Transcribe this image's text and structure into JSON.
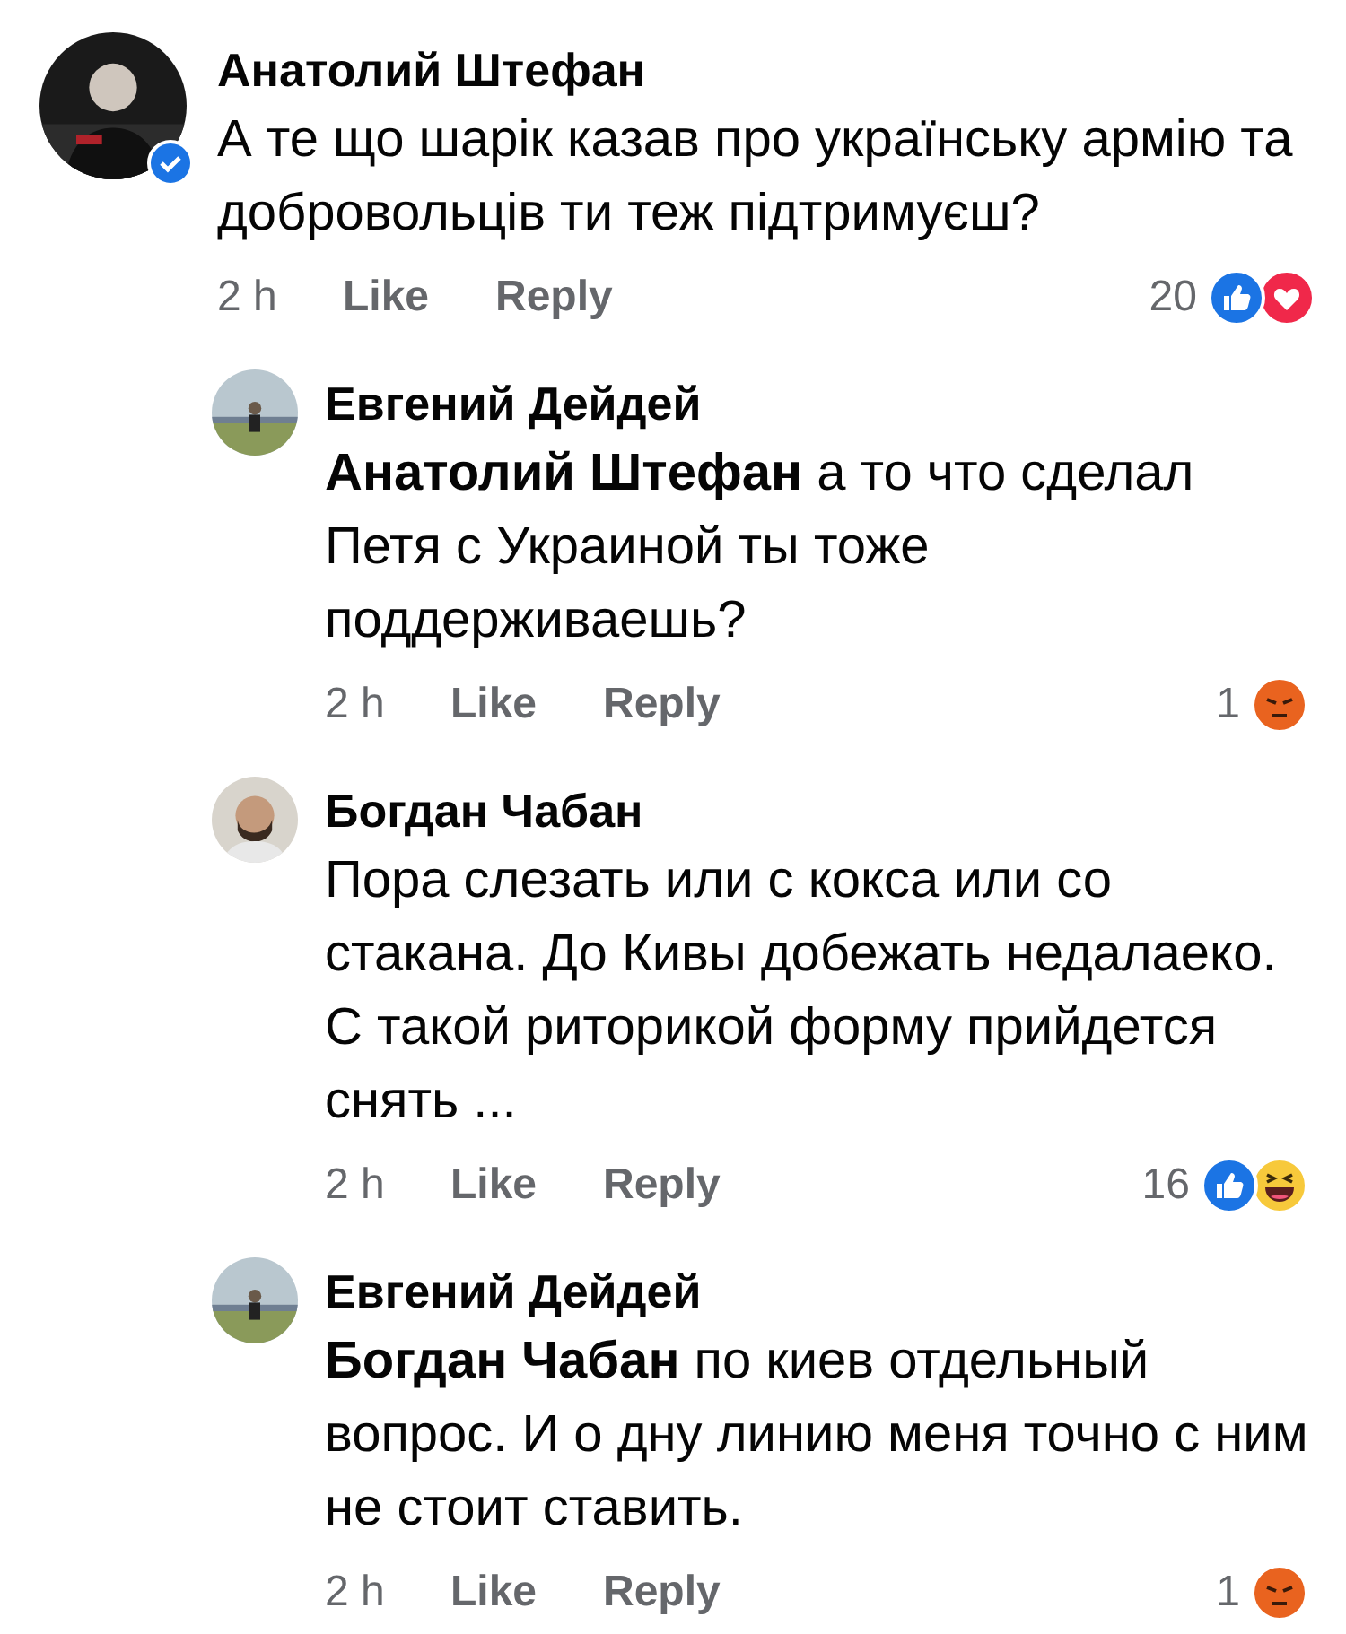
{
  "comments": [
    {
      "author": "Анатолий Штефан",
      "verified": true,
      "text": "А те що шарік казав про українську армію та добровольців ти теж підтримуєш?",
      "time": "2 h",
      "like": "Like",
      "reply": "Reply",
      "reaction_count": "20",
      "reactions": [
        {
          "kind": "like"
        },
        {
          "kind": "love"
        }
      ],
      "replies": [
        {
          "author": "Евгений Дейдей",
          "mention": "Анатолий Штефан",
          "text": "а то что сделал Петя с Украиной ты тоже поддерживаешь?",
          "time": "2 h",
          "like": "Like",
          "reply": "Reply",
          "reaction_count": "1",
          "reactions": [
            {
              "kind": "angry"
            }
          ]
        },
        {
          "author": "Богдан Чабан",
          "text": "Пора слезать или с кокса или со стакана. До Кивы добежать недалаеко. С такой риторикой форму прийдется снять ...",
          "time": "2 h",
          "like": "Like",
          "reply": "Reply",
          "reaction_count": "16",
          "reactions": [
            {
              "kind": "like"
            },
            {
              "kind": "haha"
            }
          ]
        },
        {
          "author": "Евгений Дейдей",
          "mention": "Богдан Чабан",
          "text": "по киев отдельный вопрос. И о дну линию меня точно с ним не стоит ставить.",
          "time": "2 h",
          "like": "Like",
          "reply": "Reply",
          "reaction_count": "1",
          "reactions": [
            {
              "kind": "angry"
            }
          ]
        }
      ]
    }
  ]
}
